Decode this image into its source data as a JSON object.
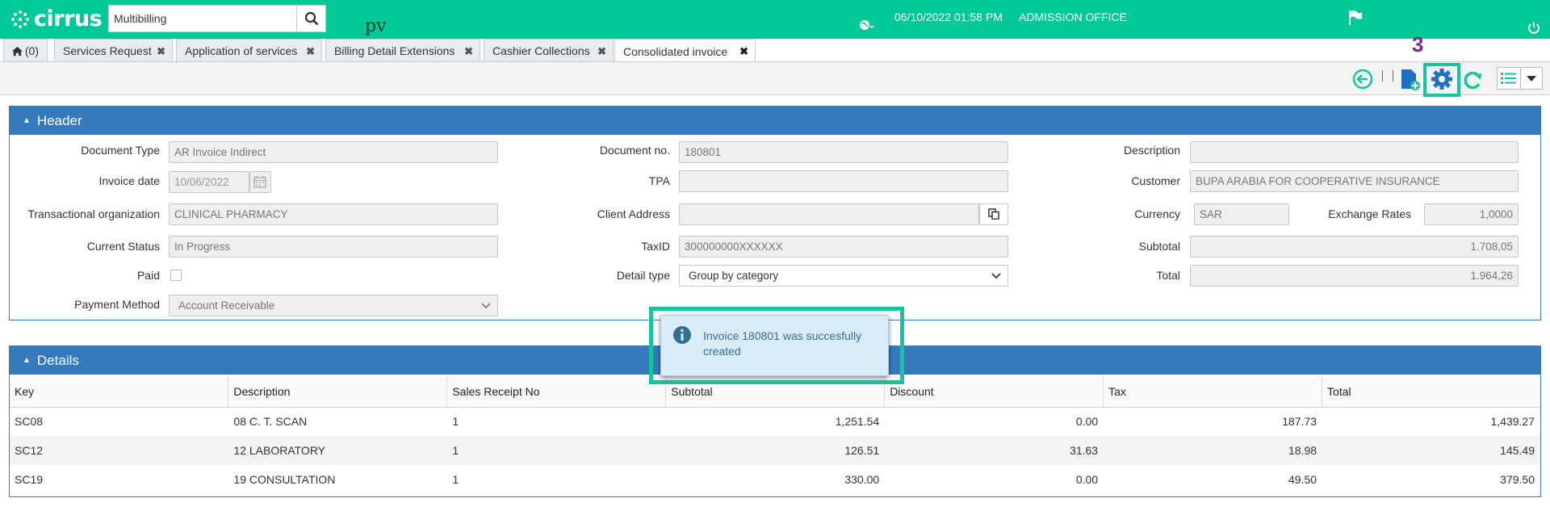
{
  "app": {
    "logo_text": "cirrus"
  },
  "search": {
    "value": "Multibilling"
  },
  "top": {
    "pv_text": "pv",
    "datetime": "06/10/2022 01:58 PM",
    "office": "ADMISSION OFFICE"
  },
  "tabs": [
    {
      "label": "(0)"
    },
    {
      "label": "Services Request"
    },
    {
      "label": "Application of services"
    },
    {
      "label": "Billing Detail Extensions"
    },
    {
      "label": "Cashier Collections"
    },
    {
      "label": "Consolidated invoice"
    }
  ],
  "annotation": {
    "step": "3"
  },
  "header": {
    "title": "Header",
    "document_type_label": "Document Type",
    "document_type": "AR Invoice Indirect",
    "invoice_date_label": "Invoice date",
    "invoice_date": "10/06/2022",
    "trans_org_label": "Transactional organization",
    "trans_org": "CLINICAL PHARMACY",
    "status_label": "Current Status",
    "status": "In Progress",
    "paid_label": "Paid",
    "payment_method_label": "Payment Method",
    "payment_method": "Account Receivable",
    "document_no_label": "Document no.",
    "document_no": "180801",
    "tpa_label": "TPA",
    "tpa": "",
    "client_address_label": "Client Address",
    "client_address": "",
    "taxid_label": "TaxID",
    "taxid": "300000000XXXXXX",
    "detail_type_label": "Detail type",
    "detail_type": "Group by category",
    "description_label": "Description",
    "description": "",
    "customer_label": "Customer",
    "customer": "BUPA ARABIA FOR COOPERATIVE INSURANCE",
    "currency_label": "Currency",
    "currency": "SAR",
    "exchange_label": "Exchange Rates",
    "exchange": "1,0000",
    "subtotal_label": "Subtotal",
    "subtotal": "1.708,05",
    "total_label": "Total",
    "total": "1.964,26"
  },
  "details": {
    "title": "Details",
    "columns": [
      "Key",
      "Description",
      "Sales Receipt No",
      "Subtotal",
      "Discount",
      "Tax",
      "Total"
    ],
    "rows": [
      [
        "SC08",
        "08 C. T. SCAN",
        "1",
        "1,251.54",
        "0.00",
        "187.73",
        "1,439.27"
      ],
      [
        "SC12",
        "12 LABORATORY",
        "1",
        "126.51",
        "31.63",
        "18.98",
        "145.49"
      ],
      [
        "SC19",
        "19 CONSULTATION",
        "1",
        "330.00",
        "0.00",
        "49.50",
        "379.50"
      ]
    ]
  },
  "toast": {
    "message": "Invoice 180801 was succesfully created"
  }
}
